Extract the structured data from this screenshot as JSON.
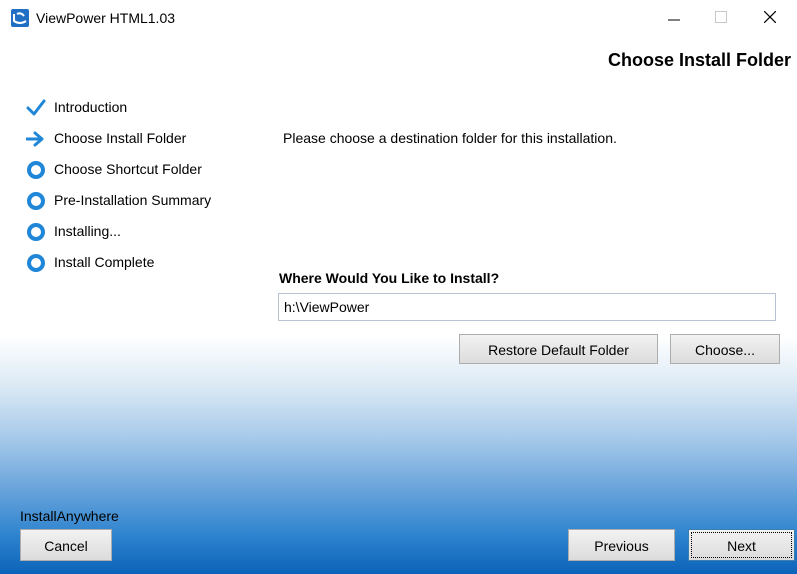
{
  "window": {
    "title": "ViewPower HTML1.03",
    "app_icon": "viewpower-app-icon",
    "controls": {
      "minimize": "minimize-icon",
      "maximize": "maximize-icon",
      "close": "close-icon"
    }
  },
  "header": {
    "title": "Choose Install Folder"
  },
  "steps": [
    {
      "label": "Introduction",
      "state": "done",
      "icon": "checkmark-icon"
    },
    {
      "label": "Choose Install Folder",
      "state": "current",
      "icon": "arrow-right-icon"
    },
    {
      "label": "Choose Shortcut Folder",
      "state": "pending",
      "icon": "bullet-icon"
    },
    {
      "label": "Pre-Installation Summary",
      "state": "pending",
      "icon": "bullet-icon"
    },
    {
      "label": "Installing...",
      "state": "pending",
      "icon": "bullet-icon"
    },
    {
      "label": "Install Complete",
      "state": "pending",
      "icon": "bullet-icon"
    }
  ],
  "content": {
    "prompt": "Please choose a destination folder for this installation.",
    "install_label": "Where Would You Like to Install?",
    "folder_value": "h:\\ViewPower",
    "restore_button": "Restore Default Folder",
    "choose_button": "Choose..."
  },
  "footer": {
    "brand": "InstallAnywhere",
    "cancel": "Cancel",
    "previous": "Previous",
    "next": "Next"
  },
  "colors": {
    "accent": "#1f86d8",
    "gradient_bottom": "#0b63b9"
  }
}
